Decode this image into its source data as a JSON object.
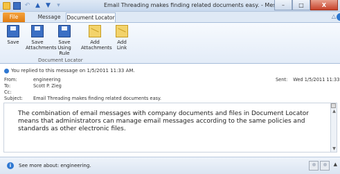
{
  "window": {
    "title": "Email Threading makes finding related documents easy.  -  Message (HTML)",
    "controls": {
      "minimize": "–",
      "maximize": "□",
      "close": "X"
    }
  },
  "tabs": [
    "File",
    "Message",
    "Document Locator"
  ],
  "ribbon": {
    "buttons": [
      {
        "label": "Save",
        "icon": "save-icon"
      },
      {
        "label": "Save Attachments",
        "icon": "save-attachments-icon"
      },
      {
        "label": "Save Using Rule",
        "icon": "save-rule-icon"
      },
      {
        "label": "Add Attachments",
        "icon": "add-attachments-icon"
      },
      {
        "label": "Add Link",
        "icon": "add-link-icon"
      }
    ],
    "group_label": "Document Locator"
  },
  "message": {
    "info": "You replied to this message on 1/5/2011 11:33 AM.",
    "from_label": "From:",
    "from": "engineering",
    "to_label": "To:",
    "to": "Scott P. Zieg",
    "cc_label": "Cc:",
    "cc": "",
    "subject_label": "Subject:",
    "subject": "Email Threading makes finding related documents easy.",
    "sent_label": "Sent:",
    "sent": "Wed 1/5/2011 11:33 AM",
    "body": "The combination of email messages with company documents and files in Document Locator means that administrators can manage email messages according to the same policies and standards as other electronic files."
  },
  "bottom": {
    "text": "See more about: engineering."
  }
}
